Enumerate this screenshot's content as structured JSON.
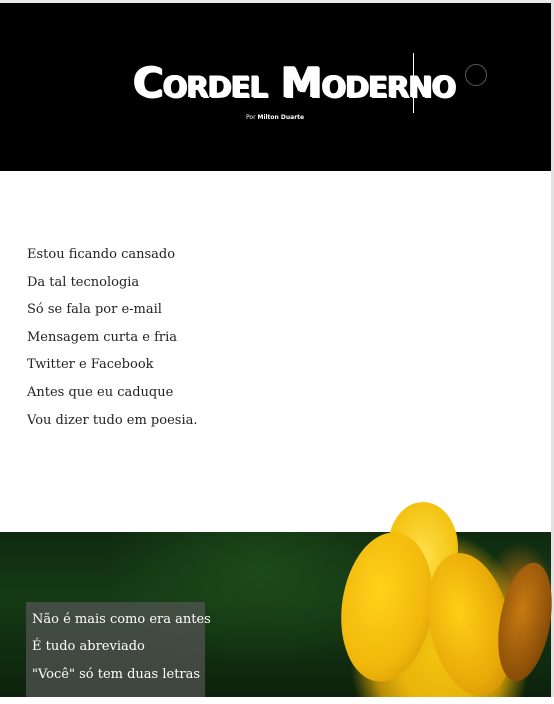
{
  "header": {
    "title": "Cordel Moderno",
    "byline_prefix": "Por",
    "byline_author": "Milton Duarte"
  },
  "poem": {
    "lines": [
      "Estou ficando cansado",
      "Da tal tecnologia",
      "Só se fala por e-mail",
      "Mensagem curta e fria",
      "Twitter e Facebook",
      "Antes que eu caduque",
      "Vou dizer tudo em poesia."
    ]
  },
  "image_section": {
    "lines": [
      "Não é mais como era antes",
      "É tudo abreviado",
      "\"Você\" só tem duas letras"
    ]
  },
  "colors": {
    "header_bg": "#000000",
    "text": "#222222",
    "overlay_box": "#555555"
  }
}
